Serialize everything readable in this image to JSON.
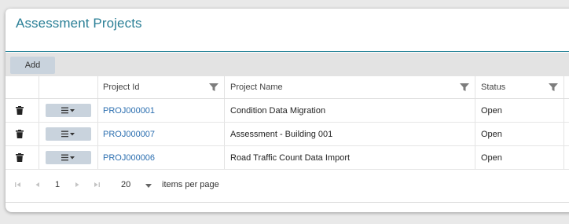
{
  "page": {
    "title": "Assessment Projects"
  },
  "toolbar": {
    "add_label": "Add"
  },
  "columns": [
    "Project Id",
    "Project Name",
    "Status"
  ],
  "rows": [
    {
      "id": "PROJ000001",
      "name": "Condition Data Migration",
      "status": "Open"
    },
    {
      "id": "PROJ000007",
      "name": "Assessment - Building 001",
      "status": "Open"
    },
    {
      "id": "PROJ000006",
      "name": "Road Traffic Count Data Import",
      "status": "Open"
    }
  ],
  "pager": {
    "current_page": "1",
    "page_size": "20",
    "items_per_page_label": "items per page"
  },
  "icons": {
    "delete": "trash-icon",
    "actions": "menu-dropdown-icon",
    "filter": "filter-icon",
    "pager_first": "first-page-icon",
    "pager_prev": "previous-page-icon",
    "pager_next": "next-page-icon",
    "pager_last": "last-page-icon"
  },
  "colors": {
    "title": "#2a7f96",
    "link": "#2c6fb0",
    "button": "#c9d3dd"
  }
}
